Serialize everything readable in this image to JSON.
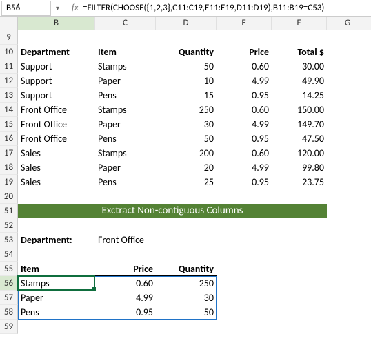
{
  "name_box": "B56",
  "fx_label": "fx",
  "formula": "=FILTER(CHOOSE({1,2,3},C11:C19,E11:E19,D11:D19),B11:B19=C53)",
  "col_labels": {
    "B": "B",
    "C": "C",
    "D": "D",
    "E": "E",
    "F": "F",
    "G": "G"
  },
  "row_labels": [
    "9",
    "10",
    "11",
    "12",
    "13",
    "14",
    "15",
    "16",
    "17",
    "18",
    "19",
    "20",
    "51",
    "52",
    "53",
    "54",
    "55",
    "56",
    "57",
    "58",
    "59"
  ],
  "table": {
    "headers": {
      "dept": "Department",
      "item": "Item",
      "qty": "Quantity",
      "price": "Price",
      "total": "Total  $"
    },
    "rows": [
      {
        "dept": "Support",
        "item": "Stamps",
        "qty": "50",
        "price": "0.60",
        "total": "30.00"
      },
      {
        "dept": "Support",
        "item": "Paper",
        "qty": "10",
        "price": "4.99",
        "total": "49.90"
      },
      {
        "dept": "Support",
        "item": "Pens",
        "qty": "15",
        "price": "0.95",
        "total": "14.25"
      },
      {
        "dept": "Front Office",
        "item": "Stamps",
        "qty": "250",
        "price": "0.60",
        "total": "150.00"
      },
      {
        "dept": "Front Office",
        "item": "Paper",
        "qty": "30",
        "price": "4.99",
        "total": "149.70"
      },
      {
        "dept": "Front Office",
        "item": "Pens",
        "qty": "50",
        "price": "0.95",
        "total": "47.50"
      },
      {
        "dept": "Sales",
        "item": "Stamps",
        "qty": "200",
        "price": "0.60",
        "total": "120.00"
      },
      {
        "dept": "Sales",
        "item": "Paper",
        "qty": "20",
        "price": "4.99",
        "total": "99.80"
      },
      {
        "dept": "Sales",
        "item": "Pens",
        "qty": "25",
        "price": "0.95",
        "total": "23.75"
      }
    ]
  },
  "banner": "Exctract Non-contiguous Columns",
  "filter": {
    "label": "Department:",
    "value": "Front Office",
    "headers": {
      "item": "Item",
      "price": "Price",
      "qty": "Quantity"
    },
    "rows": [
      {
        "item": "Stamps",
        "price": "0.60",
        "qty": "250"
      },
      {
        "item": "Paper",
        "price": "4.99",
        "qty": "30"
      },
      {
        "item": "Pens",
        "price": "0.95",
        "qty": "50"
      }
    ]
  }
}
